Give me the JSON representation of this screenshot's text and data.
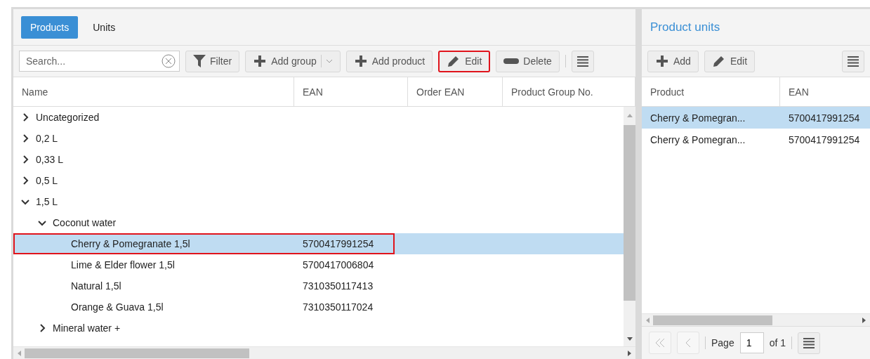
{
  "tabs": [
    {
      "label": "Products",
      "selected": true
    },
    {
      "label": "Units",
      "selected": false
    }
  ],
  "search": {
    "placeholder": "Search..."
  },
  "toolbar": [
    {
      "kind": "filter",
      "label": "Filter",
      "highlighted": false
    },
    {
      "kind": "split",
      "label": "Add group",
      "highlighted": false
    },
    {
      "kind": "add",
      "label": "Add product",
      "highlighted": false
    },
    {
      "kind": "edit",
      "label": "Edit",
      "highlighted": true
    },
    {
      "kind": "delete",
      "label": "Delete",
      "highlighted": false
    },
    {
      "kind": "menu",
      "highlighted": false
    }
  ],
  "columns": [
    "Name",
    "EAN",
    "Order EAN",
    "Product Group No."
  ],
  "tree": [
    {
      "kind": "group",
      "name": "Uncategorized",
      "expanded": false
    },
    {
      "kind": "group",
      "name": "0,2 L",
      "expanded": false
    },
    {
      "kind": "group",
      "name": "0,33 L",
      "expanded": false
    },
    {
      "kind": "group",
      "name": "0,5 L",
      "expanded": false
    },
    {
      "kind": "group",
      "name": "1,5 L",
      "expanded": true,
      "children": [
        {
          "kind": "group",
          "name": "Coconut water",
          "expanded": true,
          "children": [
            {
              "kind": "product",
              "name": "Cherry & Pomegranate 1,5l",
              "ean": "5700417991254",
              "selected": true,
              "highlighted": true
            },
            {
              "kind": "product",
              "name": "Lime & Elder flower 1,5l",
              "ean": "5700417006804",
              "selected": false,
              "highlighted": false
            },
            {
              "kind": "product",
              "name": "Natural 1,5l",
              "ean": "7310350117413",
              "selected": false,
              "highlighted": false
            },
            {
              "kind": "product",
              "name": "Orange & Guava 1,5l",
              "ean": "7310350117024",
              "selected": false,
              "highlighted": false
            }
          ]
        },
        {
          "kind": "group",
          "name": "Mineral water +",
          "expanded": false
        }
      ]
    }
  ],
  "units": {
    "title": "Product units",
    "toolbar": [
      {
        "kind": "add",
        "label": "Add"
      },
      {
        "kind": "edit",
        "label": "Edit"
      },
      {
        "kind": "menu"
      }
    ],
    "columns": [
      "Product",
      "EAN"
    ],
    "rows": [
      {
        "product": "Cherry & Pomegran...",
        "ean": "5700417991254",
        "selected": true
      },
      {
        "product": "Cherry & Pomegran...",
        "ean": "5700417991254",
        "selected": false
      }
    ],
    "pager": {
      "label": "Page",
      "value": "1",
      "total": "of 1"
    }
  }
}
